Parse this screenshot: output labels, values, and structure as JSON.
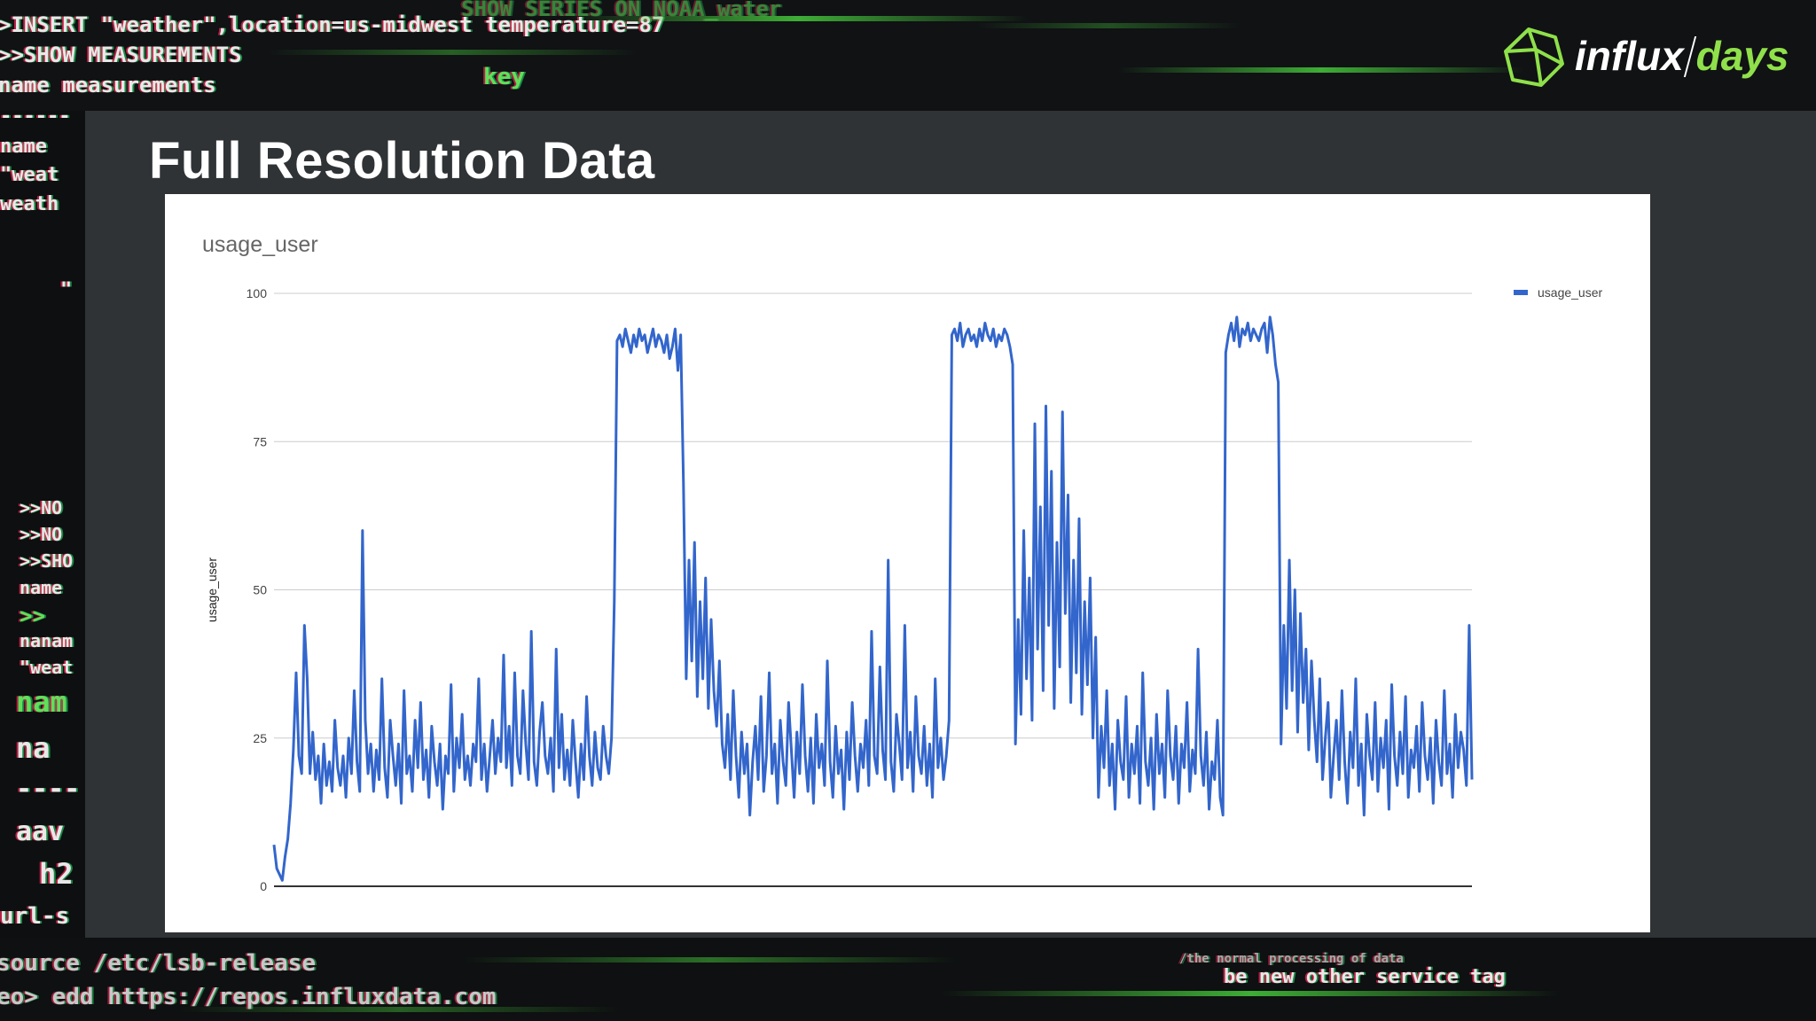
{
  "slide": {
    "title": "Full Resolution Data"
  },
  "brand": {
    "part1": "influx",
    "part2": "days",
    "accent_color": "#8fe04a"
  },
  "background_code": {
    "top_lines": [
      ">INSERT \"weather\",location=us-midwest temperature=87",
      ">>SHOW MEASUREMENTS",
      "name measurements",
      "key",
      "SHOW SERIES ON NOAA_water"
    ],
    "left_lines": [
      "------",
      "name",
      "\"weat",
      "weath",
      "\"",
      ">>NO",
      ">>NO",
      ">>SHO",
      "name",
      ">>",
      "nanam",
      "\"weat",
      "nam",
      "na",
      "----",
      "aav",
      "h2",
      "url-s"
    ],
    "bottom_lines": [
      "source /etc/lsb-release",
      "eo> edd https://repos.influxdata.com",
      "be new other service tag",
      "/the normal processing of data"
    ]
  },
  "chart_data": {
    "type": "line",
    "title": "usage_user",
    "ylabel": "usage_user",
    "xlabel": "",
    "ylim": [
      0,
      100
    ],
    "yticks": [
      "0",
      "25",
      "50",
      "75",
      "100"
    ],
    "grid": true,
    "legend": "top-right",
    "series": [
      {
        "name": "usage_user",
        "color": "#3366cc",
        "values": [
          7,
          3,
          2,
          1,
          5,
          8,
          14,
          23,
          36,
          22,
          19,
          44,
          35,
          19,
          26,
          18,
          22,
          14,
          24,
          17,
          21,
          16,
          28,
          20,
          17,
          22,
          15,
          25,
          19,
          33,
          21,
          16,
          60,
          28,
          19,
          24,
          16,
          23,
          18,
          35,
          20,
          15,
          28,
          22,
          17,
          24,
          14,
          33,
          19,
          22,
          16,
          28,
          20,
          31,
          18,
          23,
          15,
          27,
          21,
          17,
          24,
          13,
          22,
          19,
          34,
          16,
          25,
          20,
          29,
          18,
          22,
          17,
          24,
          21,
          35,
          18,
          24,
          16,
          22,
          28,
          19,
          25,
          21,
          39,
          20,
          27,
          17,
          36,
          22,
          19,
          33,
          24,
          18,
          43,
          21,
          17,
          26,
          31,
          22,
          19,
          25,
          16,
          40,
          20,
          29,
          18,
          23,
          17,
          28,
          21,
          15,
          24,
          18,
          32,
          22,
          17,
          26,
          20,
          18,
          27,
          22,
          19,
          25,
          48,
          92,
          93,
          91,
          94,
          92,
          90,
          93,
          91,
          94,
          92,
          93,
          90,
          92,
          94,
          91,
          93,
          92,
          90,
          93,
          89,
          91,
          94,
          87,
          93,
          68,
          35,
          55,
          38,
          58,
          32,
          48,
          35,
          52,
          30,
          45,
          33,
          27,
          38,
          24,
          20,
          29,
          18,
          33,
          22,
          15,
          26,
          19,
          24,
          12,
          21,
          27,
          18,
          32,
          16,
          22,
          36,
          19,
          24,
          14,
          28,
          21,
          17,
          31,
          23,
          15,
          26,
          19,
          34,
          22,
          16,
          25,
          14,
          29,
          20,
          24,
          17,
          38,
          21,
          15,
          27,
          19,
          23,
          13,
          26,
          18,
          31,
          22,
          16,
          24,
          20,
          28,
          17,
          43,
          22,
          19,
          37,
          23,
          18,
          55,
          21,
          16,
          29,
          24,
          18,
          44,
          20,
          26,
          16,
          32,
          22,
          19,
          27,
          17,
          24,
          15,
          35,
          20,
          25,
          18,
          22,
          28,
          93,
          94,
          92,
          95,
          91,
          93,
          94,
          92,
          93,
          91,
          94,
          92,
          95,
          93,
          92,
          94,
          91,
          93,
          92,
          94,
          93,
          91,
          88,
          24,
          45,
          29,
          60,
          35,
          52,
          28,
          78,
          40,
          64,
          33,
          81,
          44,
          70,
          30,
          58,
          37,
          80,
          46,
          66,
          31,
          55,
          36,
          62,
          29,
          48,
          34,
          52,
          25,
          42,
          15,
          27,
          20,
          33,
          17,
          24,
          13,
          28,
          21,
          18,
          32,
          15,
          24,
          19,
          27,
          14,
          36,
          21,
          17,
          25,
          13,
          29,
          19,
          24,
          15,
          33,
          22,
          18,
          27,
          14,
          24,
          20,
          31,
          16,
          23,
          19,
          40,
          22,
          17,
          26,
          13,
          21,
          18,
          28,
          15,
          12,
          90,
          93,
          95,
          92,
          96,
          91,
          94,
          93,
          95,
          92,
          94,
          93,
          92,
          94,
          95,
          90,
          96,
          93,
          88,
          85,
          24,
          44,
          30,
          55,
          33,
          50,
          26,
          46,
          31,
          40,
          23,
          38,
          28,
          21,
          35,
          18,
          25,
          31,
          15,
          22,
          28,
          18,
          33,
          21,
          14,
          26,
          20,
          35,
          17,
          24,
          12,
          29,
          22,
          18,
          31,
          16,
          25,
          20,
          28,
          13,
          34,
          22,
          17,
          26,
          19,
          32,
          15,
          23,
          20,
          27,
          16,
          31,
          22,
          18,
          25,
          14,
          28,
          21,
          17,
          33,
          19,
          24,
          15,
          29,
          20,
          26,
          23,
          17,
          44,
          18
        ]
      }
    ]
  }
}
